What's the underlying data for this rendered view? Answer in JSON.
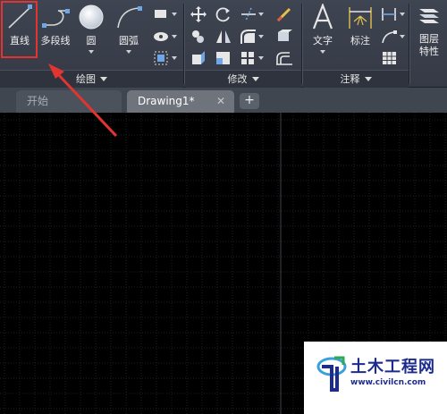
{
  "ribbon": {
    "draw_panel": {
      "title": "绘图",
      "tools": {
        "line": "直线",
        "polyline": "多段线",
        "circle": "圆",
        "arc": "圆弧"
      }
    },
    "modify_panel": {
      "title": "修改"
    },
    "annotation_panel": {
      "title": "注释",
      "tools": {
        "text": "文字",
        "dimension": "标注"
      }
    },
    "layers_panel": {
      "label_line1": "图层",
      "label_line2": "特性"
    }
  },
  "tabs": {
    "start": "开始",
    "drawing": "Drawing1*",
    "close_glyph": "✕",
    "add_glyph": "+"
  },
  "highlight": {
    "color": "#e3342f",
    "target": "直线"
  },
  "watermark": {
    "title": "土木工程网",
    "url": "www.civilcn.com"
  },
  "colors": {
    "ribbon_bg": "#3b404b",
    "canvas_bg": "#000000",
    "grid_minor": "#1d1f22",
    "grid_major": "#34373c",
    "annotation_red": "#e3342f"
  },
  "icons": {
    "line": "line-icon",
    "polyline": "polyline-icon",
    "circle": "circle-icon",
    "arc": "arc-icon",
    "text": "text-A-icon",
    "dimension": "dimension-icon"
  }
}
